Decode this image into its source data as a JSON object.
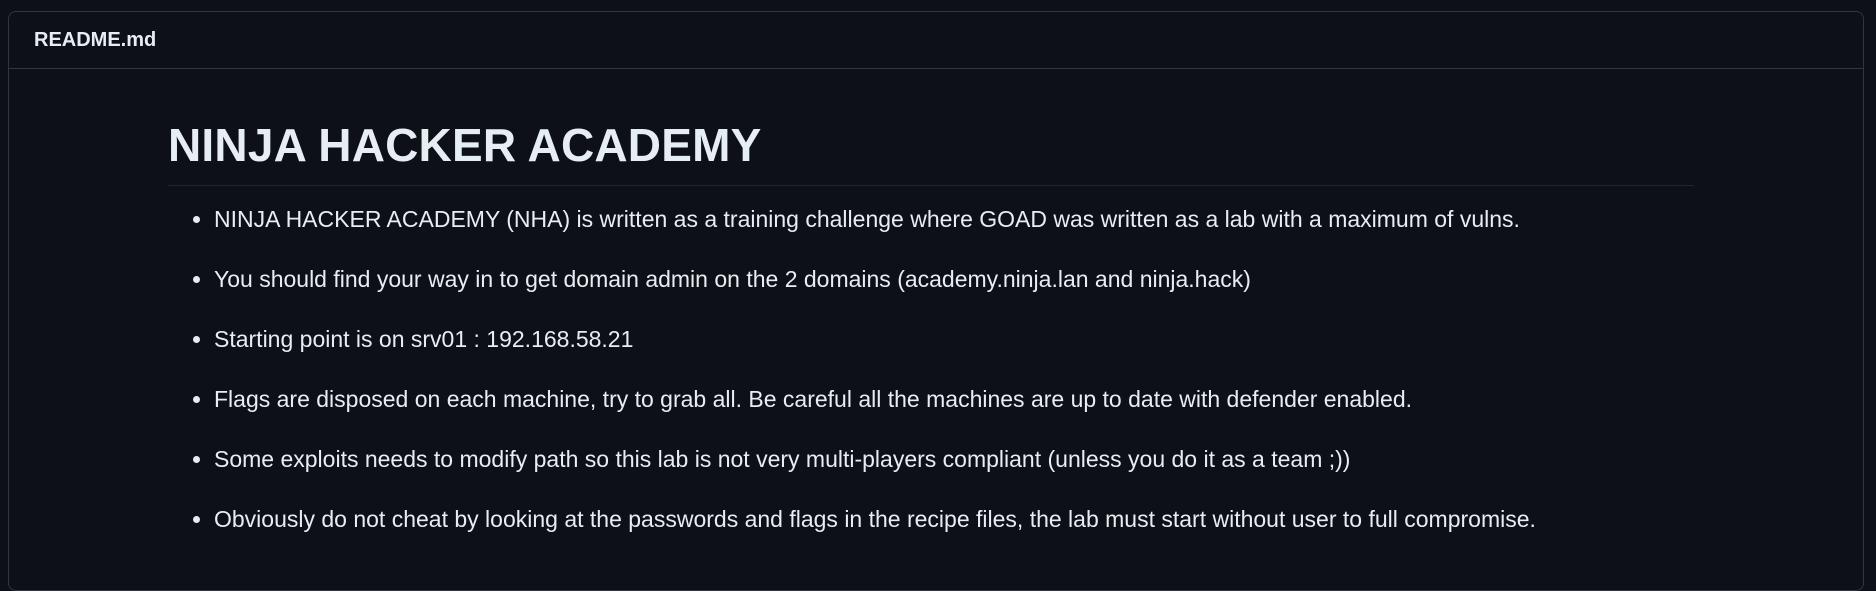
{
  "readme": {
    "filename": "README.md",
    "title": "NINJA HACKER ACADEMY",
    "items": [
      "NINJA HACKER ACADEMY (NHA) is written as a training challenge where GOAD was written as a lab with a maximum of vulns.",
      "You should find your way in to get domain admin on the 2 domains (academy.ninja.lan and ninja.hack)",
      "Starting point is on srv01 : 192.168.58.21",
      "Flags are disposed on each machine, try to grab all. Be careful all the machines are up to date with defender enabled.",
      "Some exploits needs to modify path so this lab is not very multi-players compliant (unless you do it as a team ;))",
      "Obviously do not cheat by looking at the passwords and flags in the recipe files, the lab must start without user to full compromise."
    ]
  },
  "colors": {
    "background": "#0d1117",
    "border": "#30363d",
    "text": "#e6edf3"
  }
}
